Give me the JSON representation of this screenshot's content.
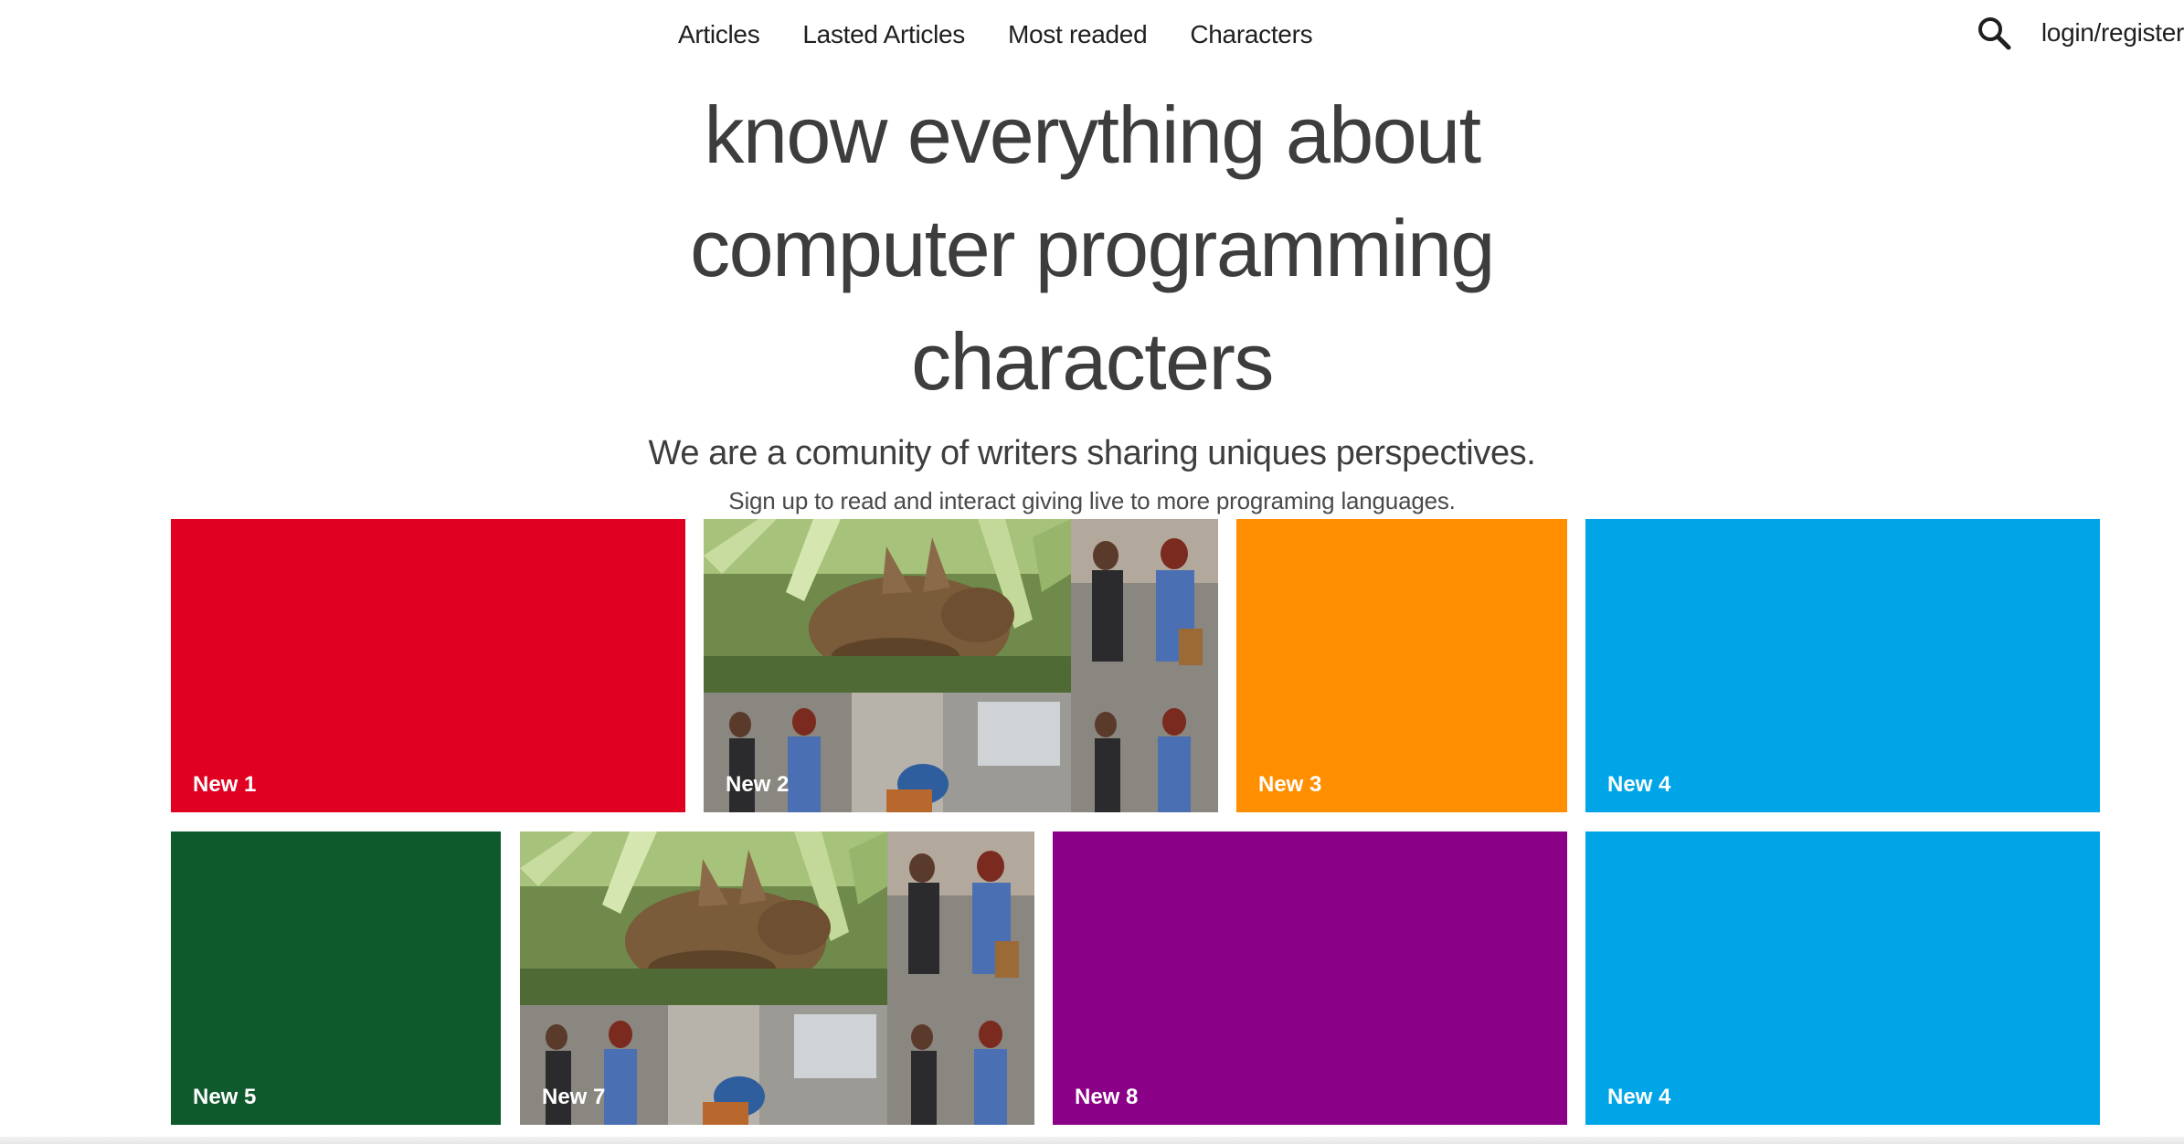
{
  "nav": {
    "links": [
      "Articles",
      "Lasted Articles",
      "Most readed",
      "Characters"
    ],
    "login_label": "login/register",
    "search_icon": "search-icon"
  },
  "hero": {
    "title": "know everything about computer programming characters",
    "subtitle": "We are a comunity of writers sharing uniques perspectives.",
    "text": "Sign up to read and interact giving live to more programing languages."
  },
  "tiles": [
    {
      "label": "New 1",
      "color": "#e00022",
      "kind": "color"
    },
    {
      "label": "New 2",
      "color": "#7a8a5a",
      "kind": "photo"
    },
    {
      "label": "New 3",
      "color": "#ff8f00",
      "kind": "color"
    },
    {
      "label": "New 4",
      "color": "#00a5e8",
      "kind": "color"
    },
    {
      "label": "New 5",
      "color": "#0e5a2c",
      "kind": "color"
    },
    {
      "label": "New 7",
      "color": "#7a8a5a",
      "kind": "photo"
    },
    {
      "label": "New 8",
      "color": "#8a0087",
      "kind": "color"
    },
    {
      "label": "New 4",
      "color": "#00a5e8",
      "kind": "color"
    }
  ]
}
